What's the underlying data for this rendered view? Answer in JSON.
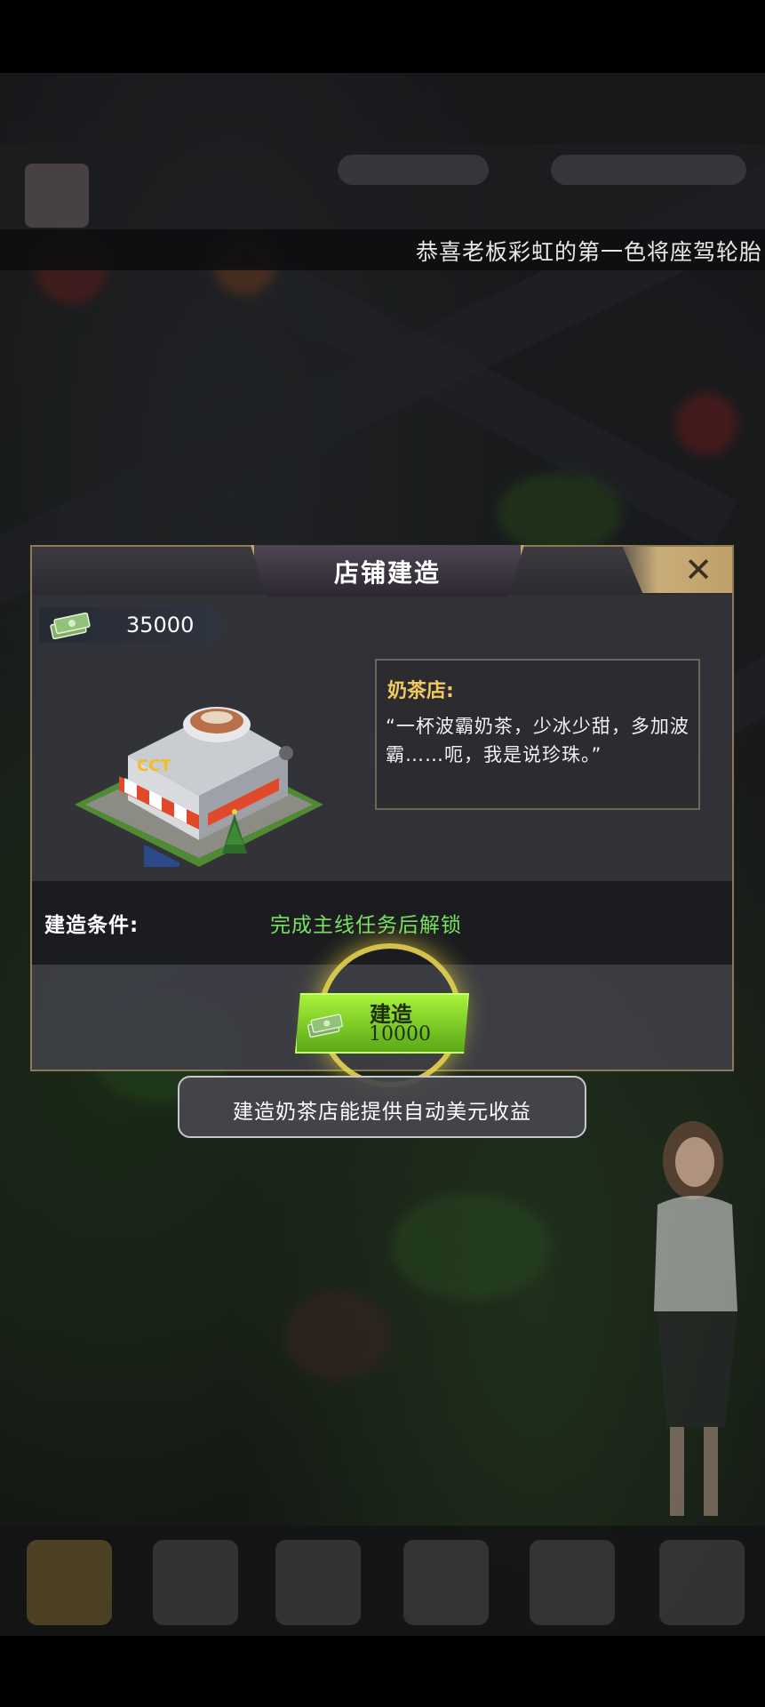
{
  "ticker": {
    "text": "恭喜老板彩虹的第一色将座驾轮胎"
  },
  "dialog": {
    "title": "店铺建造",
    "close_label": "✕",
    "money": "35000",
    "shop_name": "奶茶店:",
    "shop_description": "“一杯波霸奶茶，少冰少甜，多加波霸……呃，我是说珍珠。”",
    "condition_label": "建造条件:",
    "condition_value": "完成主线任务后解锁",
    "build_label": "建造",
    "build_cost": "10000"
  },
  "tip": {
    "text": "建造奶茶店能提供自动美元收益"
  },
  "icons": {
    "money": "money-stack-icon",
    "close": "close-icon",
    "shop": "milk-tea-shop-icon"
  },
  "colors": {
    "accent_gold": "#c8a260",
    "condition_green": "#78e060",
    "button_green": "#7fd12a",
    "shop_title": "#f4c860"
  }
}
